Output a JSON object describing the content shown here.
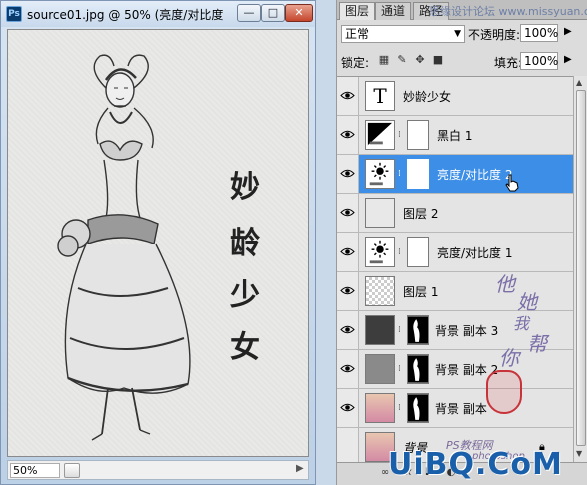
{
  "document": {
    "title": "source01.jpg @ 50% (亮度/对比度",
    "zoom": "50%",
    "artwork_text": [
      "妙",
      "龄",
      "少",
      "女"
    ]
  },
  "window_buttons": {
    "minimize": "—",
    "maximize": "□",
    "close": "✕"
  },
  "panel": {
    "tabs": [
      "图层",
      "通道",
      "路径"
    ],
    "active_tab": "图层",
    "watermark_top": "思缘设计论坛 www.missyuan.com",
    "blend_mode": "正常",
    "opacity_label": "不透明度:",
    "opacity_value": "100%",
    "lock_label": "锁定:",
    "fill_label": "填充:",
    "fill_value": "100%",
    "layers": [
      {
        "name": "妙龄少女",
        "kind": "text",
        "thumb_icon": "T",
        "visible": true,
        "selected": false
      },
      {
        "name": "黑白 1",
        "kind": "adjustment-bw",
        "visible": true,
        "selected": false
      },
      {
        "name": "亮度/对比度 2",
        "kind": "adjustment-bc",
        "visible": true,
        "selected": true
      },
      {
        "name": "图层 2",
        "kind": "fill",
        "visible": true,
        "selected": false
      },
      {
        "name": "亮度/对比度 1",
        "kind": "adjustment-bc",
        "visible": true,
        "selected": false
      },
      {
        "name": "图层 1",
        "kind": "pixel",
        "visible": true,
        "selected": false
      },
      {
        "name": "背景 副本 3",
        "kind": "masked-photo",
        "visible": true,
        "selected": false
      },
      {
        "name": "背景 副本 2",
        "kind": "masked-photo",
        "visible": true,
        "selected": false
      },
      {
        "name": "背景 副本",
        "kind": "masked-photo",
        "visible": true,
        "selected": false
      },
      {
        "name": "背景",
        "kind": "background",
        "visible": false,
        "selected": false
      }
    ],
    "bottom_icons": [
      "link-icon",
      "fx-icon",
      "mask-icon",
      "adjustment-icon",
      "group-icon",
      "new-layer-icon",
      "trash-icon"
    ]
  },
  "overlays": {
    "ps_watermark": "PS教程网",
    "ps_watermark2": "photoshop",
    "site_logo": "UiBQ.CoM",
    "calligraphy": [
      "他",
      "她",
      "我",
      "帮",
      "你"
    ]
  },
  "colors": {
    "selected_layer": "#3d8ee6",
    "title_bar": "#c8d9ec",
    "close_button": "#c4462d"
  }
}
